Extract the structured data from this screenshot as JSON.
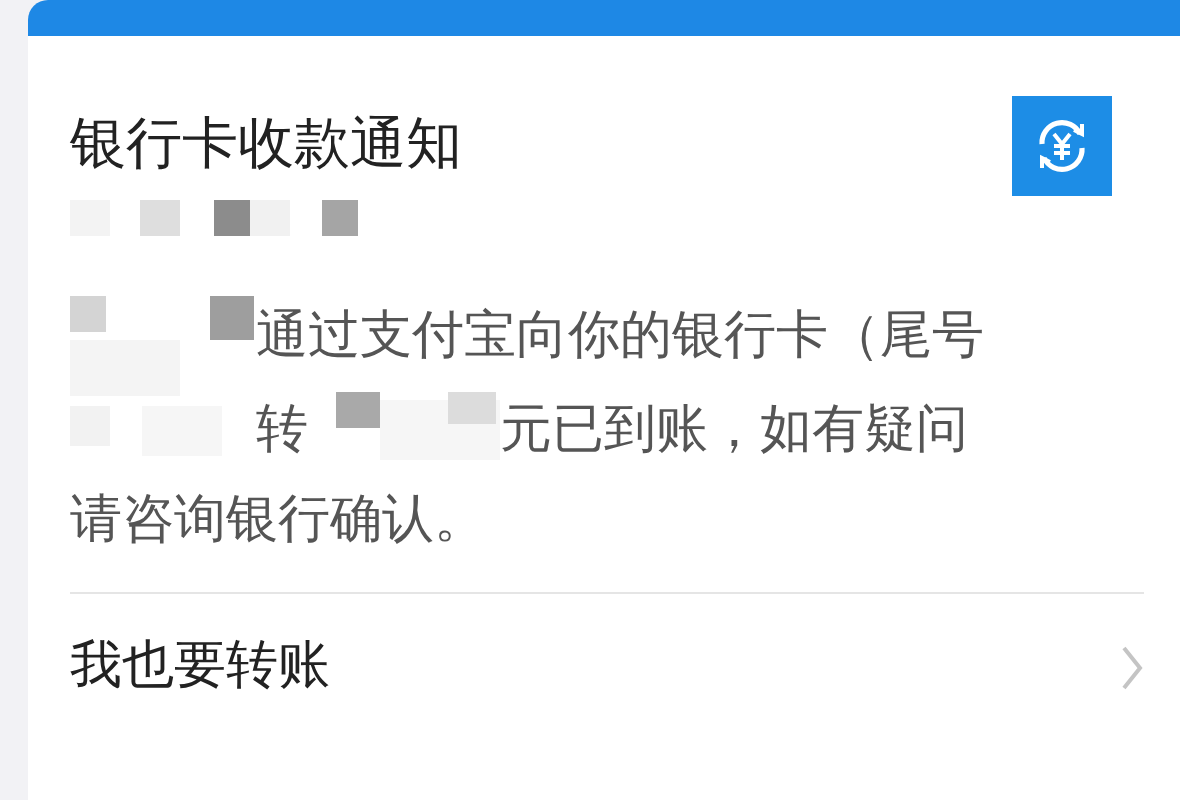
{
  "card": {
    "title": "银行卡收款通知",
    "message_lines": [
      {
        "text": "通过支付宝向你的银行卡（尾号"
      },
      {
        "text": "转",
        "rest": "元已到账，如有疑问"
      },
      {
        "text": "请咨询银行确认。"
      }
    ],
    "action": {
      "label": "我也要转账"
    }
  }
}
